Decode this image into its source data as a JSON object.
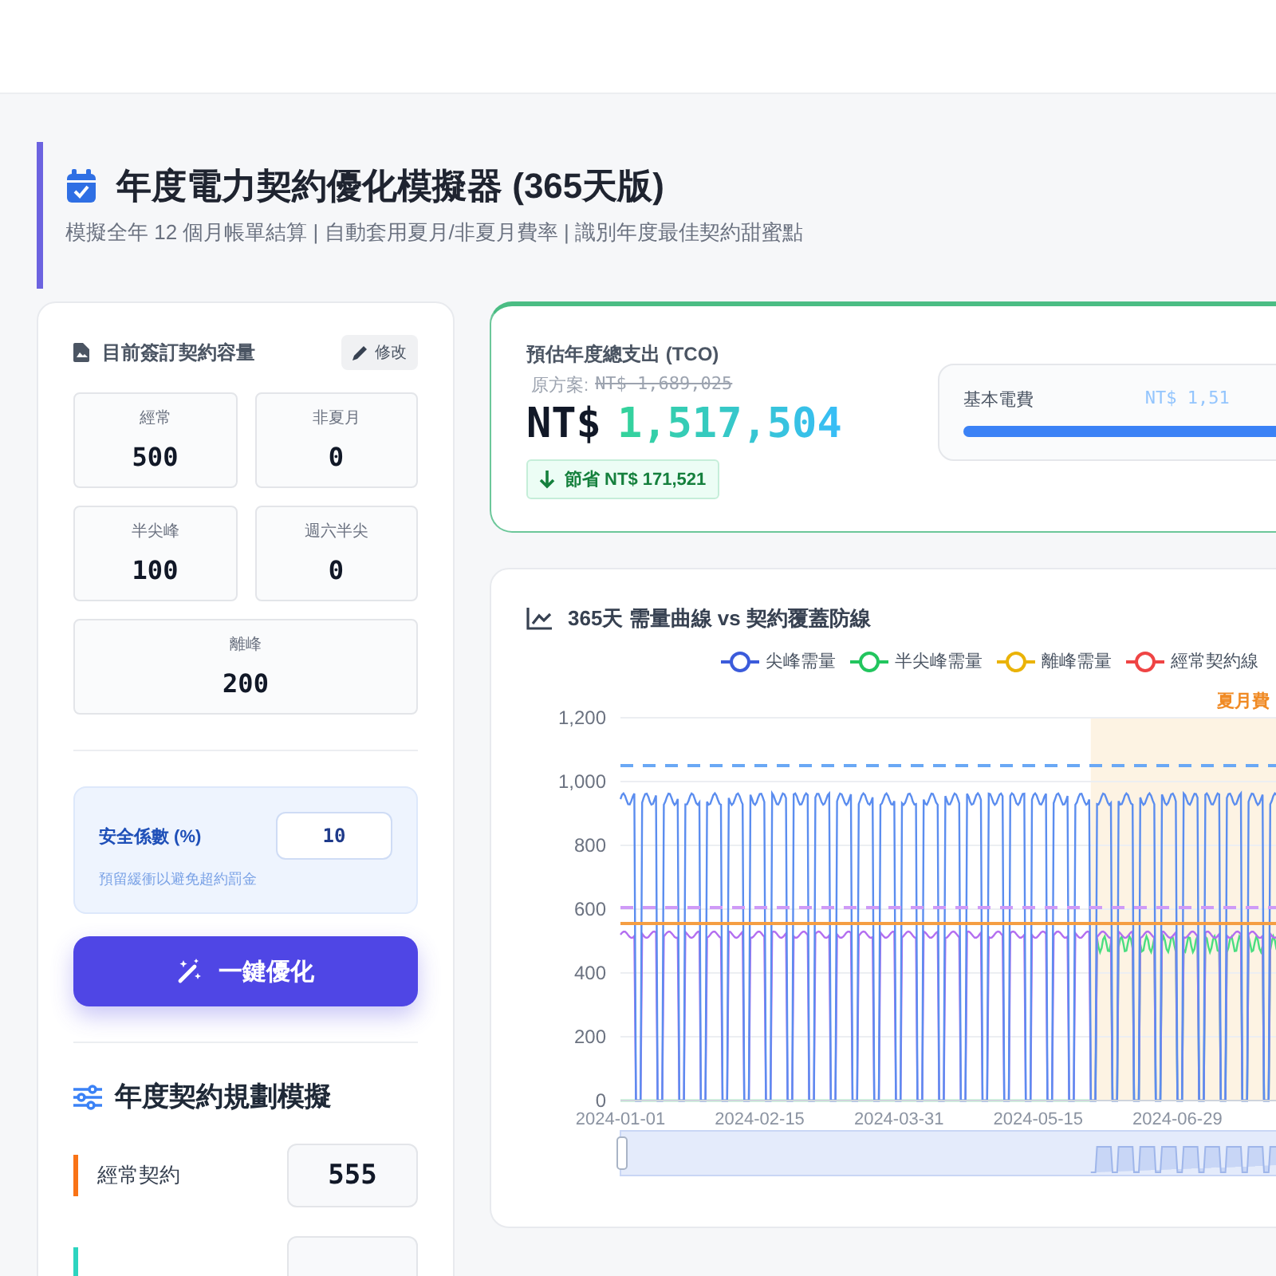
{
  "header": {
    "title": "年度電力契約優化模擬器 (365天版)",
    "subtitle": "模擬全年 12 個月帳單結算 | 自動套用夏月/非夏月費率 | 識別年度最佳契約甜蜜點"
  },
  "contract": {
    "title": "目前簽訂契約容量",
    "edit_button": "修改",
    "cells": [
      {
        "label": "經常",
        "value": "500"
      },
      {
        "label": "非夏月",
        "value": "0"
      },
      {
        "label": "半尖峰",
        "value": "100"
      },
      {
        "label": "週六半尖",
        "value": "0"
      },
      {
        "label": "離峰",
        "value": "200"
      }
    ]
  },
  "safety": {
    "label": "安全係數 (%)",
    "value": "10",
    "hint": "預留緩衝以避免超約罰金"
  },
  "optimize_button": "一鍵優化",
  "planning": {
    "title": "年度契約規劃模擬",
    "rows": [
      {
        "label": "經常契約",
        "value": "555",
        "color": "#f97316"
      },
      {
        "color": "#2dd4bf"
      }
    ]
  },
  "tco": {
    "label": "預估年度總支出 (TCO)",
    "original_label": "原方案:",
    "original_amount": "NT$ 1,689,025",
    "currency": "NT$",
    "amount": "1,517,504",
    "savings": "節省 NT$ 171,521",
    "breakdown": [
      {
        "label": "基本電費",
        "amount": "NT$ 1,51",
        "level": 0.9
      }
    ]
  },
  "chart": {
    "title": "365天 需量曲線 vs 契約覆蓋防線",
    "legend": [
      {
        "label": "尖峰需量",
        "color": "#3b5bdb"
      },
      {
        "label": "半尖峰需量",
        "color": "#22c55e"
      },
      {
        "label": "離峰需量",
        "color": "#eab308"
      },
      {
        "label": "經常契約線",
        "color": "#ef4444"
      }
    ],
    "yticks": [
      "1,200",
      "1,000",
      "800",
      "600",
      "400",
      "200",
      "0"
    ],
    "xticks": [
      "2024-01-01",
      "2024-02-15",
      "2024-03-31",
      "2024-05-15",
      "2024-06-29"
    ],
    "band_label": "夏月費"
  }
}
